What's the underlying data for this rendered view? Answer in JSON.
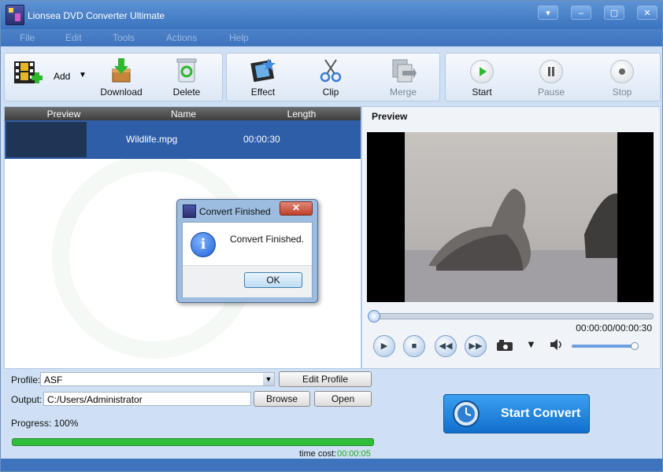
{
  "window": {
    "title": "Lionsea DVD Converter Ultimate"
  },
  "menu": [
    "File",
    "Edit",
    "Tools",
    "Actions",
    "Help"
  ],
  "toolbar": {
    "add": "Add",
    "download": "Download",
    "delete": "Delete",
    "effect": "Effect",
    "clip": "Clip",
    "merge": "Merge",
    "start": "Start",
    "pause": "Pause",
    "stop": "Stop"
  },
  "file_list": {
    "columns": [
      "Preview",
      "Name",
      "Length"
    ],
    "rows": [
      {
        "name": "Wildlife.mpg",
        "length": "00:00:30"
      }
    ]
  },
  "preview": {
    "title": "Preview",
    "time": "00:00:00/00:00:30"
  },
  "settings": {
    "profile_label": "Profile:",
    "profile_value": "ASF",
    "edit_profile": "Edit Profile",
    "output_label": "Output:",
    "output_value": "C:/Users/Administrator",
    "browse": "Browse",
    "open": "Open",
    "progress_label": "Progress: 100%",
    "progress_fraction": 1.0,
    "time_cost_label": "time cost:",
    "time_cost_value": "00:00:05",
    "start_convert": "Start Convert"
  },
  "dialog": {
    "title": "Convert Finished",
    "message": "Convert Finished.",
    "ok": "OK"
  },
  "colors": {
    "accent": "#3e74be",
    "selection": "#2e5ea8",
    "progress": "#2fbe3a",
    "time_cost": "#22aa22"
  }
}
